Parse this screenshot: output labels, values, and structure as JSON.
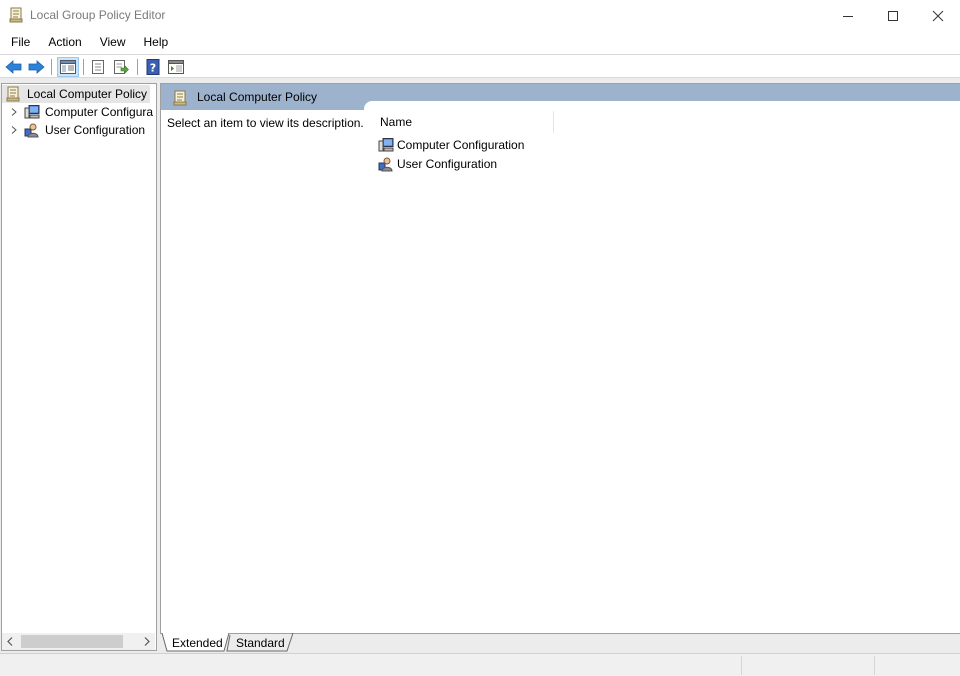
{
  "window": {
    "title": "Local Group Policy Editor",
    "icon": "policy-document-icon",
    "controls": [
      "minimize-icon",
      "maximize-icon",
      "close-icon"
    ]
  },
  "menu": {
    "items": [
      {
        "label": "File"
      },
      {
        "label": "Action"
      },
      {
        "label": "View"
      },
      {
        "label": "Help"
      }
    ]
  },
  "toolbar": {
    "buttons": [
      "back-arrow-icon",
      "forward-arrow-icon",
      "show-hide-console-tree-icon",
      "properties-icon",
      "export-list-icon",
      "help-icon",
      "show-hide-action-pane-icon"
    ],
    "active_button": "show-hide-console-tree-icon"
  },
  "tree": {
    "root": {
      "label": "Local Computer Policy",
      "icon": "policy-document-icon",
      "selected": true
    },
    "children": [
      {
        "label": "Computer Configura",
        "icon": "computer-icon",
        "expandable": true
      },
      {
        "label": "User Configuration",
        "icon": "user-icon",
        "expandable": true
      }
    ]
  },
  "details": {
    "header_title": "Local Computer Policy",
    "description": "Select an item to view its description.",
    "columns": [
      {
        "label": "Name"
      }
    ],
    "items": [
      {
        "label": "Computer Configuration",
        "icon": "computer-icon"
      },
      {
        "label": "User Configuration",
        "icon": "user-icon"
      }
    ]
  },
  "tabs": {
    "items": [
      {
        "label": "Extended",
        "active": true
      },
      {
        "label": "Standard",
        "active": false
      }
    ]
  },
  "colors": {
    "header_band": "#9db3cd",
    "tree_selected": "#e5e5e5",
    "nav_arrow": "#2c82d8"
  }
}
